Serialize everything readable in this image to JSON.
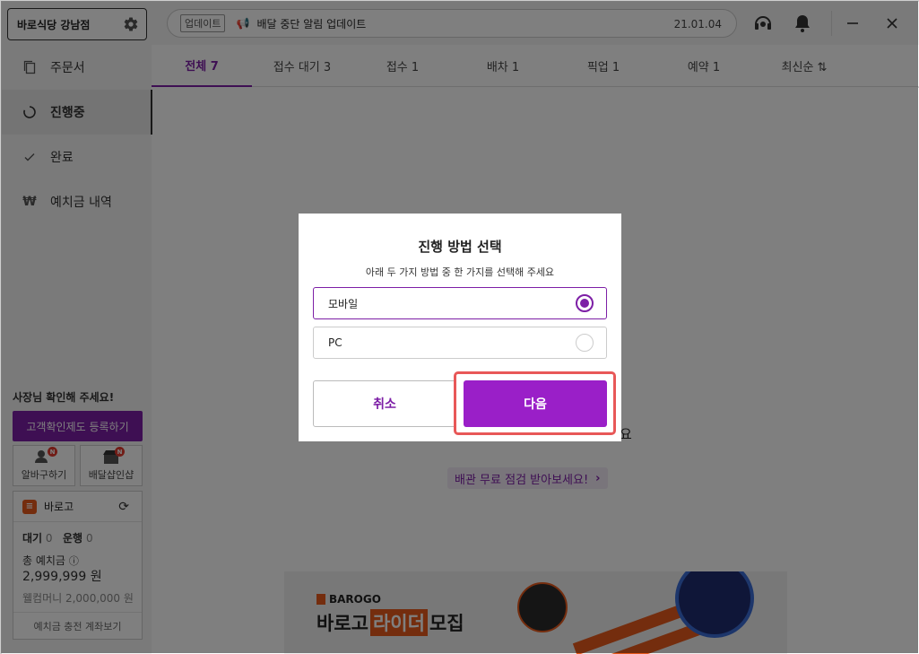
{
  "sidebar": {
    "store_name": "바로식당 강남점",
    "nav": [
      {
        "label": "주문서",
        "icon": "copy-icon"
      },
      {
        "label": "진행중",
        "icon": "progress-circle-icon"
      },
      {
        "label": "완료",
        "icon": "check-icon"
      },
      {
        "label": "예치금 내역",
        "icon": "won-icon"
      }
    ],
    "notice": "사장님 확인해 주세요!",
    "register_button": "고객확인제도 등록하기",
    "mini_buttons": [
      {
        "label": "알바구하기",
        "icon": "people-icon",
        "badge": "N"
      },
      {
        "label": "배달샵인샵",
        "icon": "shop-icon",
        "badge": "N"
      }
    ],
    "card": {
      "brand": "바로고",
      "waiting_label": "대기",
      "waiting_count": "0",
      "running_label": "운행",
      "running_count": "0",
      "deposit_label": "총 예치금",
      "deposit_amount": "2,999,999 원",
      "wellcome_money": "웰컴머니 2,000,000 원",
      "footer": "예치금 충전 계좌보기"
    }
  },
  "topbar": {
    "tag": "업데이트",
    "message": "배달 중단 알림 업데이트",
    "date": "21.01.04"
  },
  "tabs": [
    {
      "label": "전체 7"
    },
    {
      "label": "접수 대기 3"
    },
    {
      "label": "접수 1"
    },
    {
      "label": "배차 1"
    },
    {
      "label": "픽업 1"
    },
    {
      "label": "예약 1"
    },
    {
      "label": "최신순 ⇅"
    }
  ],
  "main": {
    "empty_tail": "요",
    "inspect_link": "배관 무료 점검 받아보세요!",
    "banner_brand": "BAROGO",
    "banner_title_pre": "바로고",
    "banner_title_hl": "라이더",
    "banner_title_post": "모집"
  },
  "modal": {
    "title": "진행 방법 선택",
    "subtitle": "아래 두 가지 방법 중 한 가지를 선택해 주세요",
    "options": [
      {
        "label": "모바일",
        "selected": true
      },
      {
        "label": "PC",
        "selected": false
      }
    ],
    "cancel": "취소",
    "next": "다음"
  },
  "colors": {
    "accent": "#7d1fa6",
    "next_button": "#9a1fc8",
    "highlight": "#e85858",
    "brand_orange": "#e85a1c"
  }
}
